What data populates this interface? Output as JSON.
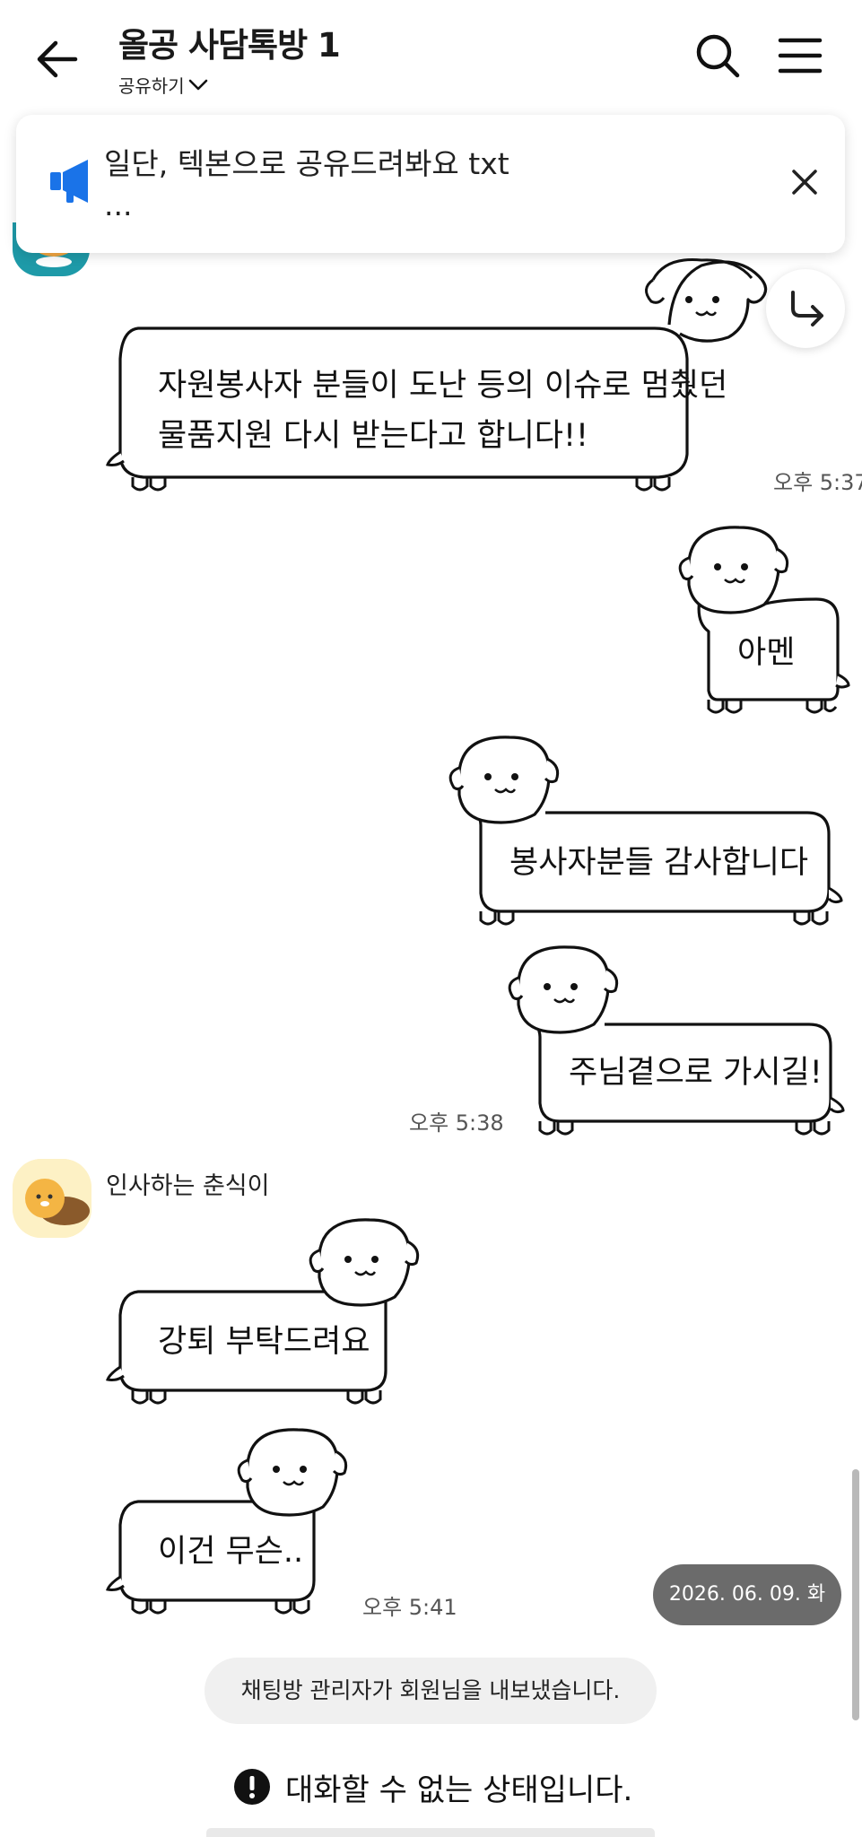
{
  "header": {
    "title": "올공 사담톡방 1",
    "share_label": "공유하기"
  },
  "notice": {
    "line1": "일단,   텍본으로 공유드려봐요 txt",
    "line2": "..."
  },
  "messages": [
    {
      "line1": "자원봉사자 분들이 도난 등의 이슈로 멈췄던",
      "line2": "물품지원 다시 받는다고 합니다!!",
      "time": "오후 5:37"
    },
    {
      "text": "아멘"
    },
    {
      "text": "봉사자분들 감사합니다"
    },
    {
      "text": "주님곁으로 가시길!",
      "time": "오후 5:38"
    },
    {
      "text": "강퇴 부탁드려요"
    },
    {
      "text": "이건 무슨..",
      "time": "오후 5:41"
    }
  ],
  "sender": {
    "name": "인사하는 춘식이"
  },
  "date_pill": "2026. 06. 09. 화",
  "system_message": "채팅방 관리자가 회원님을 내보냈습니다.",
  "disabled_notice": "대화할 수 없는 상태입니다.",
  "colors": {
    "notice_icon": "#1a73e8",
    "date_pill_bg": "#6b6b6b",
    "system_msg_bg": "#f0f0f0"
  },
  "icons": [
    "back-arrow-icon",
    "chevron-down-icon",
    "search-icon",
    "hamburger-menu-icon",
    "megaphone-icon",
    "close-icon",
    "forward-icon",
    "warning-icon"
  ]
}
